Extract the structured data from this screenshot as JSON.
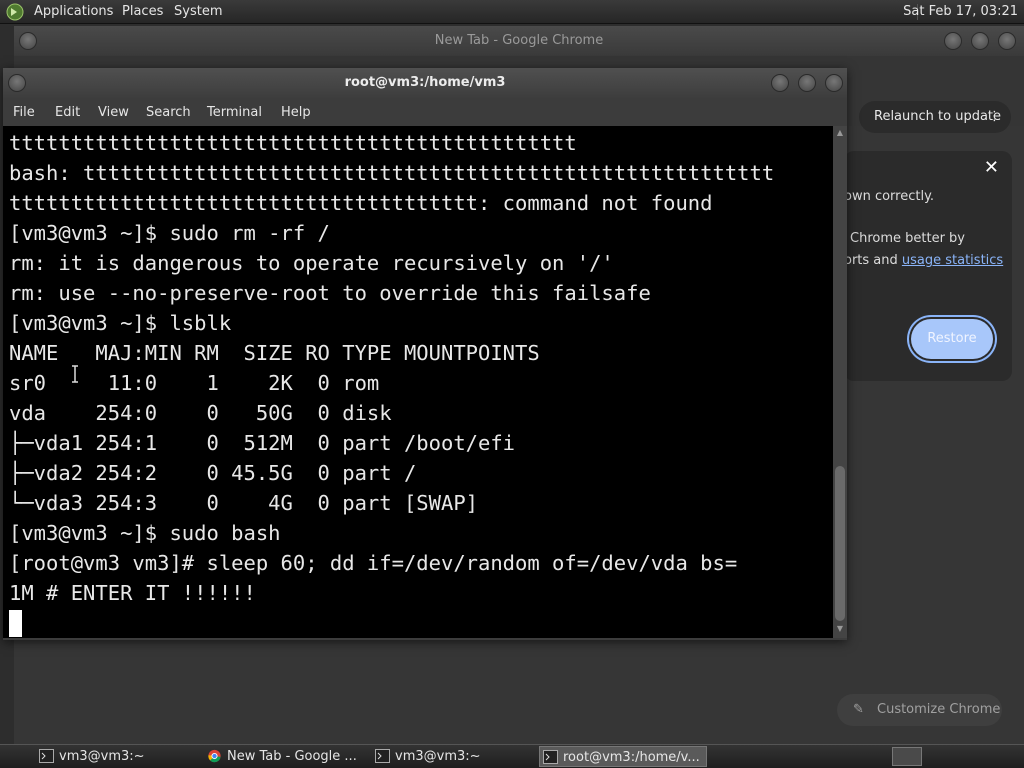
{
  "top_panel": {
    "menus": [
      "Applications",
      "Places",
      "System"
    ],
    "clock": "Sat Feb 17, 03:21"
  },
  "chrome": {
    "title": "New Tab - Google Chrome",
    "relaunch_label": "Relaunch to update",
    "popup": {
      "line1": "own correctly.",
      "line2": "Chrome better by",
      "line3_prefix": "orts and ",
      "line3_link": "usage statistics",
      "restore_label": "Restore"
    },
    "customize_label": "Customize Chrome"
  },
  "terminal": {
    "title": "root@vm3:/home/vm3",
    "menu": [
      "File",
      "Edit",
      "View",
      "Search",
      "Terminal",
      "Help"
    ],
    "lines": [
      "tttttttttttttttttttttttttttttttttttttttttttttt",
      "bash: tttttttttttttttttttttttttttttttttttttttttttttttttttttttt",
      "tttttttttttttttttttttttttttttttttttttt: command not found",
      "[vm3@vm3 ~]$ sudo rm -rf /",
      "rm: it is dangerous to operate recursively on '/'",
      "rm: use --no-preserve-root to override this failsafe",
      "[vm3@vm3 ~]$ lsblk",
      "NAME   MAJ:MIN RM  SIZE RO TYPE MOUNTPOINTS",
      "sr0     11:0    1    2K  0 rom",
      "vda    254:0    0   50G  0 disk",
      "├─vda1 254:1    0  512M  0 part /boot/efi",
      "├─vda2 254:2    0 45.5G  0 part /",
      "└─vda3 254:3    0    4G  0 part [SWAP]",
      "[vm3@vm3 ~]$ sudo bash",
      "[root@vm3 vm3]# sleep 60; dd if=/dev/random of=/dev/vda bs=",
      "1M # ENTER IT !!!!!!"
    ]
  },
  "taskbar": {
    "tasks": [
      "vm3@vm3:~",
      "New Tab - Google ...",
      "vm3@vm3:~",
      "root@vm3:/home/v..."
    ]
  }
}
